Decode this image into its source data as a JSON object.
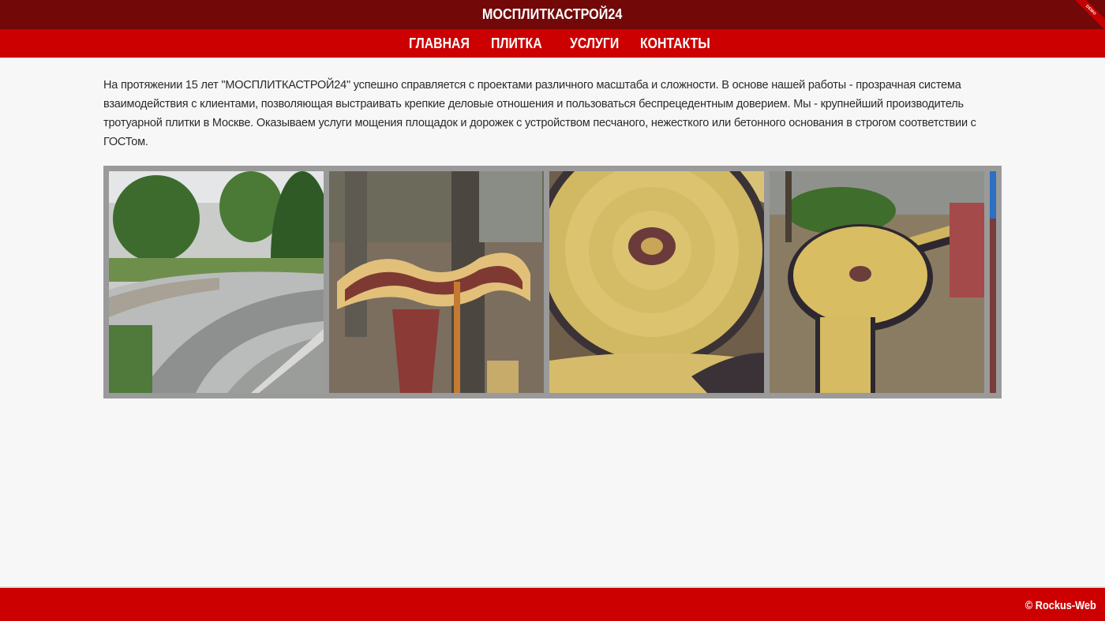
{
  "header": {
    "title": "МОСПЛИТКАСТРОЙ24",
    "ribbon_text": "DEMO"
  },
  "nav": {
    "items": [
      {
        "label": "ГЛАВНАЯ"
      },
      {
        "label": "ПЛИТКА"
      },
      {
        "label": "УСЛУГИ"
      },
      {
        "label": "КОНТАКТЫ"
      }
    ]
  },
  "main": {
    "intro_text": "На протяжении 15 лет \"МОСПЛИТКАСТРОЙ24\" успешно справляется с проектами различного масштаба и сложности. В основе нашей работы - прозрачная система взаимодействия с клиентами, позволяющая выстраивать крепкие деловые отношения и пользоваться беспрецедентным доверием. Мы - крупнейший производитель тротуарной плитки в Москве. Оказываем услуги мощения площадок и дорожек с устройством песчаного, нежесткого или бетонного основания в строгом соответствии с ГОСТом."
  },
  "gallery": {
    "photos": [
      {
        "subject": "curved grey paver walkway"
      },
      {
        "subject": "red and yellow wavy paver border around tree"
      },
      {
        "subject": "yellow circular paver pattern"
      },
      {
        "subject": "yellow circular paver patio with path"
      }
    ]
  },
  "footer": {
    "copyright": "© Rockus-Web"
  },
  "colors": {
    "title_bar": "#720808",
    "nav_bar": "#cc0000",
    "footer": "#cc0000",
    "background": "#f7f7f7",
    "gallery_frame": "#9a9a9a"
  }
}
